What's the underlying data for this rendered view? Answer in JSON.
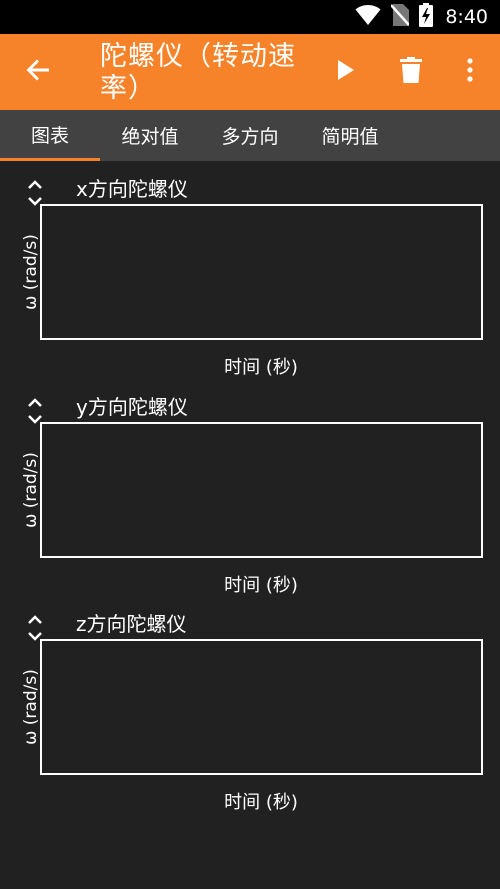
{
  "status_bar": {
    "time": "8:40",
    "icons": [
      "wifi-icon",
      "no-sim-icon",
      "battery-charging-icon"
    ]
  },
  "app_bar": {
    "title": "陀螺仪（转动速率）",
    "icons": [
      "arrow-back-icon",
      "play-icon",
      "delete-icon",
      "more-vert-icon"
    ]
  },
  "tabs": [
    {
      "label": "图表",
      "active": true
    },
    {
      "label": "绝对值",
      "active": false
    },
    {
      "label": "多方向",
      "active": false
    },
    {
      "label": "简明值",
      "active": false
    }
  ],
  "charts": [
    {
      "title": "x方向陀螺仪",
      "ylabel": "ω (rad/s)",
      "xlabel": "时间 (秒)"
    },
    {
      "title": "y方向陀螺仪",
      "ylabel": "ω (rad/s)",
      "xlabel": "时间 (秒)"
    },
    {
      "title": "z方向陀螺仪",
      "ylabel": "ω (rad/s)",
      "xlabel": "时间 (秒)"
    }
  ],
  "colors": {
    "accent": "#f6832a",
    "background": "#212121",
    "tab_bar": "#424242",
    "status_bar": "#000000"
  }
}
